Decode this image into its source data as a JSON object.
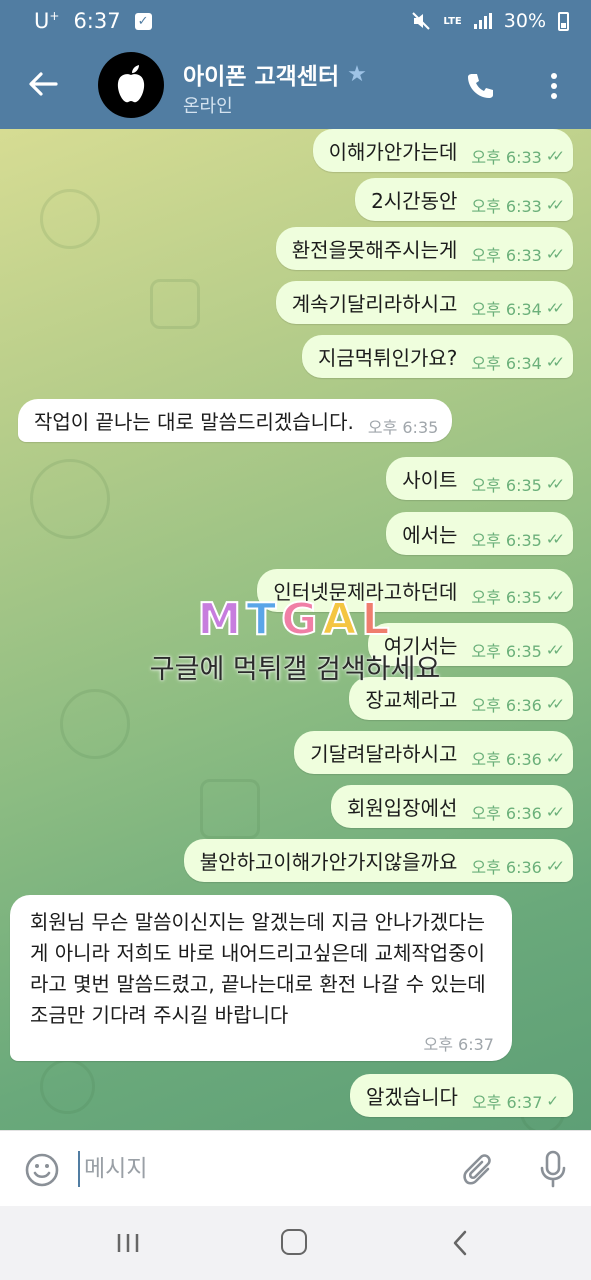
{
  "status_bar": {
    "carrier": "U",
    "carrier_sup": "+",
    "time": "6:37",
    "network": "LTE",
    "battery": "30%"
  },
  "header": {
    "title": "아이폰 고객센터",
    "subtitle": "온라인"
  },
  "messages": [
    {
      "dir": "out",
      "text": "이해가안가는데",
      "time": "오후 6:33",
      "status": "read"
    },
    {
      "dir": "out",
      "text": "2시간동안",
      "time": "오후 6:33",
      "status": "read"
    },
    {
      "dir": "out",
      "text": "환전을못해주시는게",
      "time": "오후 6:33",
      "status": "read"
    },
    {
      "dir": "out",
      "text": "계속기달리라하시고",
      "time": "오후 6:34",
      "status": "read"
    },
    {
      "dir": "out",
      "text": "지금먹튀인가요?",
      "time": "오후 6:34",
      "status": "read"
    },
    {
      "dir": "in",
      "text": "작업이 끝나는 대로 말씀드리겠습니다.",
      "time": "오후 6:35"
    },
    {
      "dir": "out",
      "text": "사이트",
      "time": "오후 6:35",
      "status": "read"
    },
    {
      "dir": "out",
      "text": "에서는",
      "time": "오후 6:35",
      "status": "read"
    },
    {
      "dir": "out",
      "text": "인터넷문제라고하던데",
      "time": "오후 6:35",
      "status": "read"
    },
    {
      "dir": "out",
      "text": "여기서는",
      "time": "오후 6:35",
      "status": "read"
    },
    {
      "dir": "out",
      "text": "장교체라고",
      "time": "오후 6:36",
      "status": "read"
    },
    {
      "dir": "out",
      "text": "기달려달라하시고",
      "time": "오후 6:36",
      "status": "read"
    },
    {
      "dir": "out",
      "text": "회원입장에선",
      "time": "오후 6:36",
      "status": "read"
    },
    {
      "dir": "out",
      "text": "불안하고이해가안가지않을까요",
      "time": "오후 6:36",
      "status": "read"
    },
    {
      "dir": "in",
      "text": "회원님 무슨 말씀이신지는 알겠는데 지금 안나가겠다는게 아니라 저희도 바로 내어드리고싶은데 교체작업중이라고 몇번 말씀드렸고, 끝나는대로 환전 나갈 수 있는데 조금만 기다려 주시길 바랍니다",
      "time": "오후 6:37"
    },
    {
      "dir": "out",
      "text": "알겠습니다",
      "time": "오후 6:37",
      "status": "sent"
    }
  ],
  "watermark": {
    "logo": "MTGAL",
    "text": "구글에 먹튀갤 검색하세요"
  },
  "input": {
    "placeholder": "메시지"
  },
  "colors": {
    "header": "#517da2",
    "bubble_out": "#effedd",
    "bubble_in": "#ffffff",
    "tick": "#6bb07a"
  }
}
